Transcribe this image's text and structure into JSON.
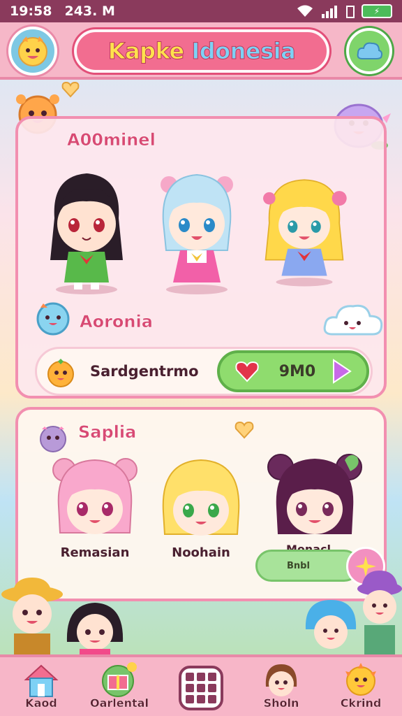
{
  "status_bar": {
    "time": "19:58",
    "date": "243. M",
    "battery": "⚡"
  },
  "header": {
    "title_part1": "Kapke",
    "title_part2": "Idonesia"
  },
  "card_one": {
    "section_title": "A00minel",
    "sub_title": "Aoronia",
    "row_label": "Sardgentrmo",
    "cost_value": "9M0"
  },
  "card_two": {
    "section_title": "Saplia",
    "characters": [
      {
        "name": "Remasian"
      },
      {
        "name": "Noohain"
      },
      {
        "name": "Monacl"
      }
    ],
    "pill_label": "Bnbl"
  },
  "bottom_nav": {
    "items": [
      {
        "label": "Kaod"
      },
      {
        "label": "Oarlental"
      },
      {
        "label": "Sholn"
      },
      {
        "label": "Ckrind"
      }
    ]
  },
  "colors": {
    "accent_pink": "#f26d90",
    "header_pink": "#f6b7c8",
    "green_button": "#8fdc6e",
    "status_bar": "#8a3a5c"
  },
  "icons": [
    "avatar-icon",
    "cloud-icon",
    "heart-icon",
    "play-icon",
    "home-icon",
    "gift-icon",
    "grid-icon",
    "face-icon",
    "sun-icon",
    "wifi-icon",
    "signal-icon",
    "battery-icon"
  ]
}
